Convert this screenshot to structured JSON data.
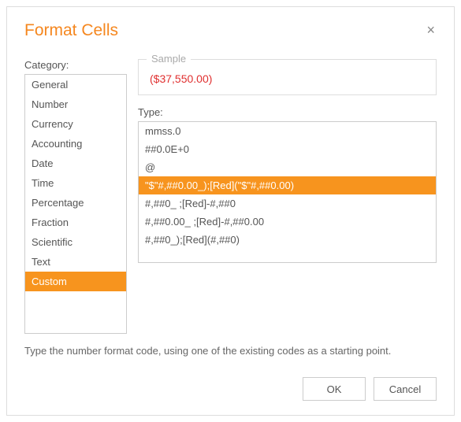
{
  "dialog": {
    "title": "Format Cells",
    "close_icon": "×"
  },
  "category": {
    "label": "Category:",
    "items": [
      "General",
      "Number",
      "Currency",
      "Accounting",
      "Date",
      "Time",
      "Percentage",
      "Fraction",
      "Scientific",
      "Text",
      "Custom"
    ],
    "selected_index": 10
  },
  "sample": {
    "legend": "Sample",
    "value": "($37,550.00)"
  },
  "type": {
    "label": "Type:",
    "items": [
      "mmss.0",
      "##0.0E+0",
      "@",
      "\"$\"#,##0.00_);[Red](\"$\"#,##0.00)",
      "#,##0_ ;[Red]-#,##0",
      "#,##0.00_ ;[Red]-#,##0.00",
      "#,##0_);[Red](#,##0)"
    ],
    "selected_index": 3
  },
  "hint": "Type the number format code, using one of the existing codes as a starting point.",
  "buttons": {
    "ok": "OK",
    "cancel": "Cancel"
  }
}
